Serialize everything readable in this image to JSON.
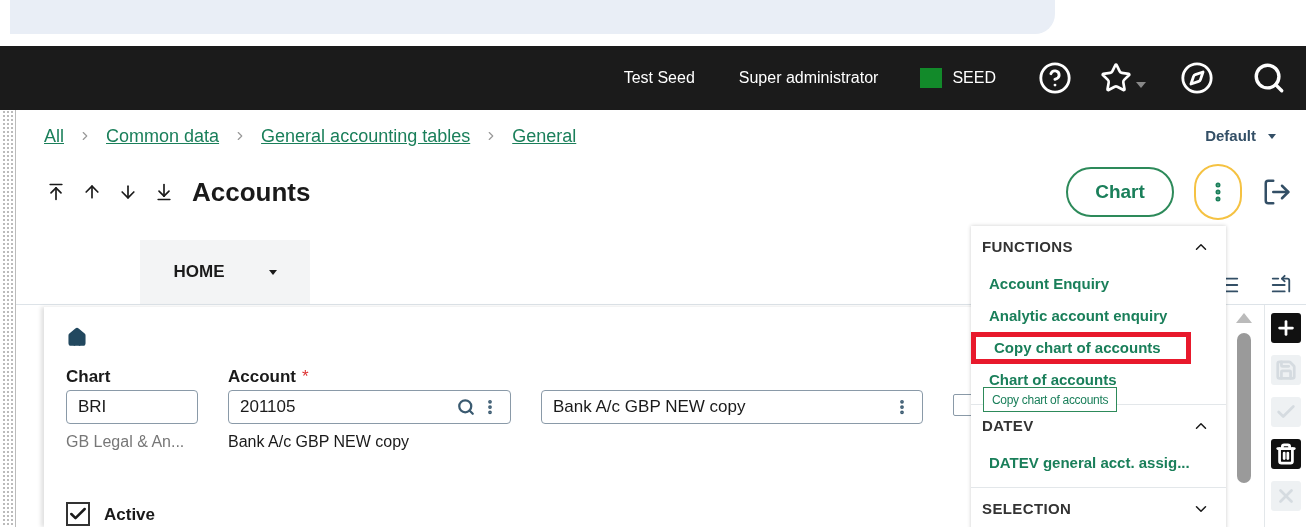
{
  "header": {
    "user": "Test Seed",
    "role": "Super administrator",
    "site": {
      "label": "SEED",
      "color": "#128a2a"
    }
  },
  "breadcrumb": [
    "All",
    "Common data",
    "General accounting tables",
    "General"
  ],
  "view_selector": "Default",
  "title": "Accounts",
  "chart_button": "Chart",
  "tabs": [
    {
      "label": "HOME",
      "selected": true
    }
  ],
  "fields": [
    {
      "kind": "plain",
      "label": "Chart",
      "value": "BRI",
      "hint": "GB Legal & An..."
    },
    {
      "kind": "lookup",
      "label": "Account",
      "required_mark": "*",
      "value": "201105",
      "hint": "Bank A/c GBP NEW copy"
    },
    {
      "kind": "menu",
      "value": "Bank A/c GBP NEW copy"
    }
  ],
  "side_checkbox": {
    "checked": false
  },
  "active": {
    "label": "Active",
    "checked": true
  },
  "toolbar": [
    {
      "kind": "add",
      "disabled": false
    },
    {
      "kind": "save",
      "disabled": true
    },
    {
      "kind": "ok",
      "disabled": true
    },
    {
      "kind": "delete",
      "disabled": false
    },
    {
      "kind": "cancel",
      "disabled": true
    }
  ],
  "menu": {
    "sections": [
      {
        "title": "FUNCTIONS",
        "expanded": true,
        "items": [
          {
            "label": "Account Enquiry",
            "highlighted": false
          },
          {
            "label": "Analytic account enquiry",
            "highlighted": false
          },
          {
            "label": "Copy chart of accounts",
            "highlighted": true
          },
          {
            "label": "Chart of accounts",
            "highlighted": false
          }
        ]
      },
      {
        "title": "DATEV",
        "expanded": true,
        "items": [
          {
            "label": "DATEV general acct. assig...",
            "highlighted": false
          }
        ]
      },
      {
        "title": "SELECTION",
        "expanded": false
      }
    ]
  },
  "tooltip": "Copy chart of accounts"
}
